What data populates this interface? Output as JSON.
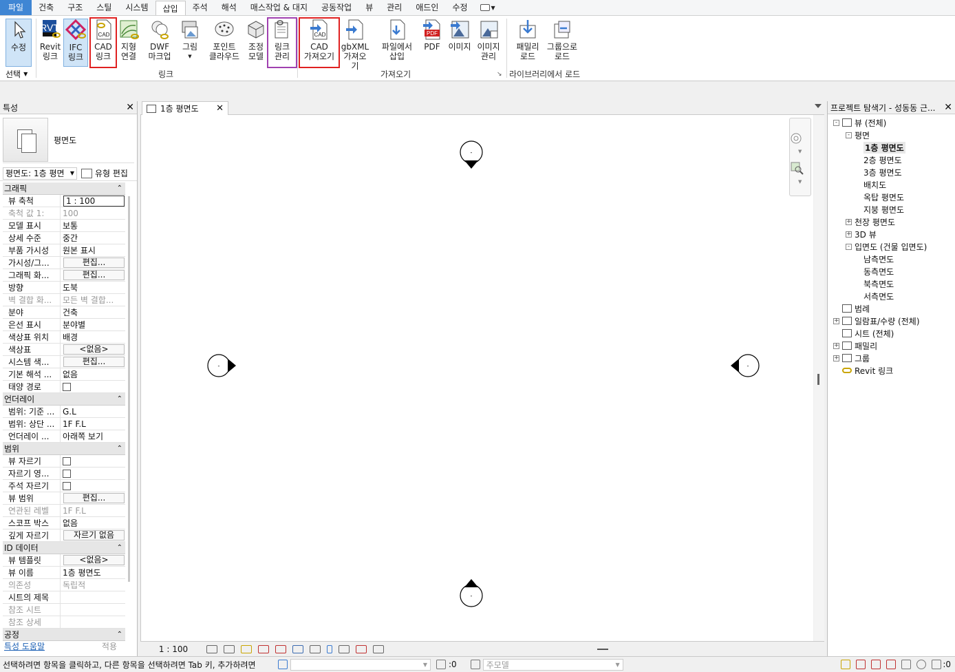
{
  "ribbon_tabs": [
    "파일",
    "건축",
    "구조",
    "스틸",
    "시스템",
    "삽입",
    "주석",
    "해석",
    "매스작업 & 대지",
    "공동작업",
    "뷰",
    "관리",
    "애드인",
    "수정"
  ],
  "ribbon": {
    "modify_label": "수정",
    "select_label": "선택",
    "revit_link": "Revit\n링크",
    "ifc_link": "IFC\n링크",
    "cad_link": "CAD\n링크",
    "topo_link": "지형\n연결",
    "dwf_markup": "DWF\n마크업",
    "picture": "그림",
    "point_cloud": "포인트\n클라우드",
    "coord_model": "조정\n모델",
    "manage_links": "링크\n관리",
    "import_cad": "CAD\n가져오기",
    "gbxml_import": "gbXML\n가져오기",
    "insert_from_file": "파일에서\n삽입",
    "pdf": "PDF",
    "image": "이미지",
    "manage_images": "이미지\n관리",
    "load_family": "패밀리\n로드",
    "load_as_group": "그룹으로\n로드",
    "group_link": "링크",
    "group_import": "가져오기",
    "group_library": "라이브러리에서 로드",
    "icon_text_cad": "CAD",
    "icon_text_pdf": "PDF",
    "icon_text_rvt": "RVT",
    "icon_text_ifc": "IFC"
  },
  "properties": {
    "title": "특성",
    "type_name": "평면도",
    "instance_selector": "평면도: 1층 평면",
    "edit_type": "유형 편집",
    "sections": [
      {
        "title": "그래픽",
        "rows": [
          {
            "name": "뷰 축척",
            "value": "1 : 100",
            "kind": "input"
          },
          {
            "name": "축척 값    1:",
            "value": "100",
            "kind": "text",
            "dim": true
          },
          {
            "name": "모델 표시",
            "value": "보통",
            "kind": "text"
          },
          {
            "name": "상세 수준",
            "value": "중간",
            "kind": "text"
          },
          {
            "name": "부품 가시성",
            "value": "원본 표시",
            "kind": "text"
          },
          {
            "name": "가시성/그...",
            "value": "편집...",
            "kind": "button"
          },
          {
            "name": "그래픽 화...",
            "value": "편집...",
            "kind": "button"
          },
          {
            "name": "방향",
            "value": "도북",
            "kind": "text"
          },
          {
            "name": "벽 결합 화...",
            "value": "모든 벽 결합...",
            "kind": "text",
            "dim": true
          },
          {
            "name": "분야",
            "value": "건축",
            "kind": "text"
          },
          {
            "name": "은선 표시",
            "value": "분야별",
            "kind": "text"
          },
          {
            "name": "색상표 위치",
            "value": "배경",
            "kind": "text"
          },
          {
            "name": "색상표",
            "value": "<없음>",
            "kind": "button"
          },
          {
            "name": "시스템 색...",
            "value": "편집...",
            "kind": "button"
          },
          {
            "name": "기본 해석 ...",
            "value": "없음",
            "kind": "text"
          },
          {
            "name": "태양 경로",
            "value": "",
            "kind": "checkbox"
          }
        ]
      },
      {
        "title": "언더레이",
        "rows": [
          {
            "name": "범위: 기준 ...",
            "value": "G.L",
            "kind": "text"
          },
          {
            "name": "범위: 상단 ...",
            "value": "1F F.L",
            "kind": "text"
          },
          {
            "name": "언더레이 ...",
            "value": "아래쪽 보기",
            "kind": "text"
          }
        ]
      },
      {
        "title": "범위",
        "rows": [
          {
            "name": "뷰 자르기",
            "value": "",
            "kind": "checkbox"
          },
          {
            "name": "자르기 영...",
            "value": "",
            "kind": "checkbox"
          },
          {
            "name": "주석 자르기",
            "value": "",
            "kind": "checkbox"
          },
          {
            "name": "뷰 범위",
            "value": "편집...",
            "kind": "button"
          },
          {
            "name": "연관된 레벨",
            "value": "1F F.L",
            "kind": "text",
            "dim": true
          },
          {
            "name": "스코프 박스",
            "value": "없음",
            "kind": "text"
          },
          {
            "name": "깊게 자르기",
            "value": "자르기 없음",
            "kind": "button"
          }
        ]
      },
      {
        "title": "ID 데이터",
        "rows": [
          {
            "name": "뷰 템플릿",
            "value": "<없음>",
            "kind": "button"
          },
          {
            "name": "뷰 이름",
            "value": "1층 평면도",
            "kind": "text"
          },
          {
            "name": "의존성",
            "value": "독립적",
            "kind": "text",
            "dim": true
          },
          {
            "name": "시트의 제목",
            "value": "",
            "kind": "text"
          },
          {
            "name": "참조 시트",
            "value": "",
            "kind": "text",
            "dim": true
          },
          {
            "name": "참조 상세",
            "value": "",
            "kind": "text",
            "dim": true
          }
        ]
      },
      {
        "title": "공정",
        "rows": []
      }
    ],
    "help_link": "특성 도움말",
    "apply": "적용"
  },
  "view": {
    "tab_title": "1층 평면도",
    "scale": "1 : 100",
    "elevation_marker_text": "-"
  },
  "browser": {
    "title": "프로젝트 탐색기 - 성동동 근...",
    "nodes": [
      {
        "label": "뷰 (전체)",
        "level": 0,
        "exp": "-",
        "icon": true
      },
      {
        "label": "평면",
        "level": 1,
        "exp": "-"
      },
      {
        "label": "1층 평면도",
        "level": 2,
        "selected": true
      },
      {
        "label": "2층 평면도",
        "level": 2
      },
      {
        "label": "3층 평면도",
        "level": 2
      },
      {
        "label": "배치도",
        "level": 2
      },
      {
        "label": "옥탑 평면도",
        "level": 2
      },
      {
        "label": "지붕 평면도",
        "level": 2
      },
      {
        "label": "천장 평면도",
        "level": 1,
        "exp": "+"
      },
      {
        "label": "3D 뷰",
        "level": 1,
        "exp": "+"
      },
      {
        "label": "입면도 (건물 입면도)",
        "level": 1,
        "exp": "-"
      },
      {
        "label": "남측면도",
        "level": 2
      },
      {
        "label": "동측면도",
        "level": 2
      },
      {
        "label": "북측면도",
        "level": 2
      },
      {
        "label": "서측면도",
        "level": 2
      },
      {
        "label": "범례",
        "level": 0,
        "icon": true
      },
      {
        "label": "일람표/수량 (전체)",
        "level": 0,
        "exp": "+",
        "icon": true
      },
      {
        "label": "시트 (전체)",
        "level": 0,
        "icon": true
      },
      {
        "label": "패밀리",
        "level": 0,
        "exp": "+",
        "icon": true
      },
      {
        "label": "그룹",
        "level": 0,
        "exp": "+",
        "icon": true
      },
      {
        "label": "Revit 링크",
        "level": 0,
        "link": true
      }
    ]
  },
  "statusbar": {
    "message": "선택하려면 항목을 클릭하고, 다른 항목을 선택하려면 Tab 키, 추가하려면",
    "count": ":0",
    "model": "주모델",
    "filter_count": ":0"
  },
  "colors": {
    "highlight_red": "#e02020",
    "highlight_purple": "#a040b0",
    "file_tab": "#3f86d4"
  }
}
